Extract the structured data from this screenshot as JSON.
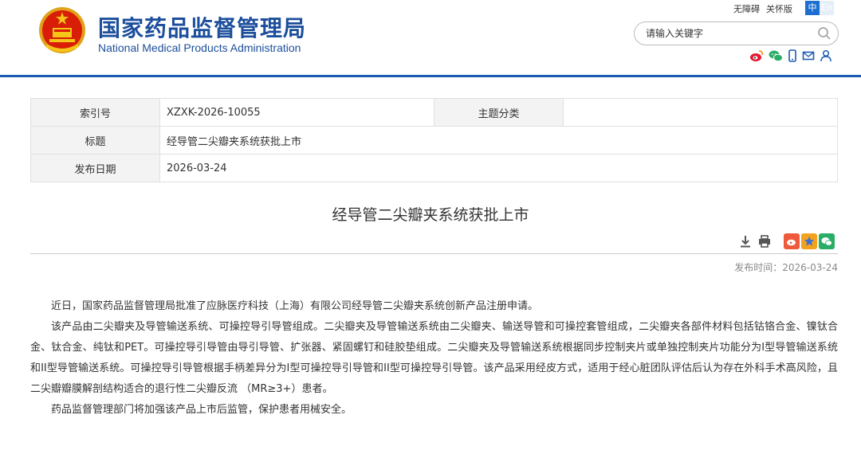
{
  "header": {
    "title_cn": "国家药品监督管理局",
    "title_en": "National Medical Products Administration",
    "accessibility": "无障碍",
    "traditional": "关怀版",
    "lang_zh": "中",
    "lang_en": "En",
    "search_placeholder": "请输入关键字"
  },
  "info": {
    "index_label": "索引号",
    "index_value": "XZXK-2026-10055",
    "category_label": "主题分类",
    "category_value": "",
    "title_label": "标题",
    "title_value": "经导管二尖瓣夹系统获批上市",
    "date_label": "发布日期",
    "date_value": "2026-03-24"
  },
  "article": {
    "title": "经导管二尖瓣夹系统获批上市",
    "pub_label": "发布时间：",
    "pub_date": "2026-03-24",
    "paragraphs": [
      "近日，国家药品监督管理局批准了应脉医疗科技（上海）有限公司经导管二尖瓣夹系统创新产品注册申请。",
      "该产品由二尖瓣夹及导管输送系统、可操控导引导管组成。二尖瓣夹及导管输送系统由二尖瓣夹、输送导管和可操控套管组成，二尖瓣夹各部件材料包括钴铬合金、镍钛合金、钛合金、纯钛和PET。可操控导引导管由导引导管、扩张器、紧固螺钉和硅胶垫组成。二尖瓣夹及导管输送系统根据同步控制夹片或单独控制夹片功能分为I型导管输送系统和II型导管输送系统。可操控导引导管根据手柄差异分为I型可操控导引导管和II型可操控导引导管。该产品采用经皮方式，适用于经心脏团队评估后认为存在外科手术高风险，且二尖瓣瓣膜解剖结构适合的退行性二尖瓣反流 （MR≥3+）患者。",
      "药品监督管理部门将加强该产品上市后监管，保护患者用械安全。"
    ]
  },
  "colors": {
    "brand": "#1c4e9c",
    "rule": "#1c5ab4"
  }
}
